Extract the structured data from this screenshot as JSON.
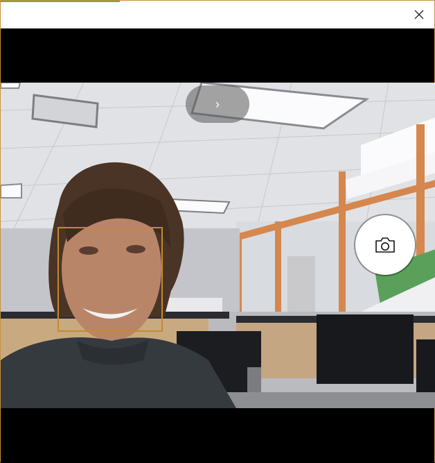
{
  "window": {
    "accent_color": "#c8913a",
    "close_icon": "close-icon"
  },
  "camera": {
    "next_icon": "chevron-right-icon",
    "next_glyph": "›",
    "shutter_icon": "camera-icon",
    "face_box_color": "#c38a2f"
  }
}
